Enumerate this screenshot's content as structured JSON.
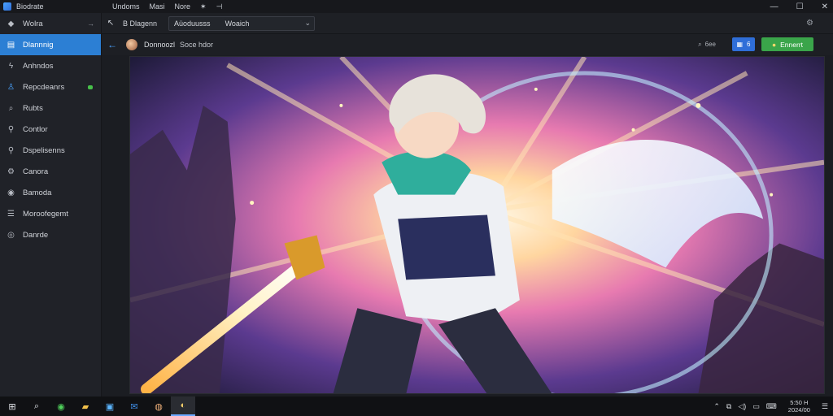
{
  "app": {
    "name": "Biodrate",
    "menu": [
      "Undoms",
      "Masi",
      "Nore"
    ],
    "window_controls": [
      "minimize",
      "maximize",
      "close"
    ]
  },
  "sidebar": {
    "items": [
      {
        "label": "Wolra",
        "icon": "home-icon",
        "trail": "→"
      },
      {
        "label": "Dlannnig",
        "icon": "document-icon",
        "active": true
      },
      {
        "label": "Anhndos",
        "icon": "bolt-icon"
      },
      {
        "label": "Repcdeanrs",
        "icon": "user-icon",
        "badge": "green-dot"
      },
      {
        "label": "Rubts",
        "icon": "search-icon"
      },
      {
        "label": "Contlor",
        "icon": "pin-icon"
      },
      {
        "label": "Dspelisenns",
        "icon": "pin-icon"
      },
      {
        "label": "Canora",
        "icon": "gear-icon"
      },
      {
        "label": "Bamoda",
        "icon": "camera-icon"
      },
      {
        "label": "Moroofegemt",
        "icon": "list-icon"
      },
      {
        "label": "Danrde",
        "icon": "disc-icon"
      }
    ]
  },
  "toolbar": {
    "left_text": "B Dlagenn",
    "select_value": "Aüoduusss",
    "select_value_2": "Woaich"
  },
  "header": {
    "title": "Donnoozl",
    "subtitle": "Soce hdor",
    "search_text": "6ee",
    "blue_button": "6",
    "green_button": "Ennerrt"
  },
  "taskbar": {
    "clock_time": "5:50 H",
    "clock_date": "2024/00"
  }
}
